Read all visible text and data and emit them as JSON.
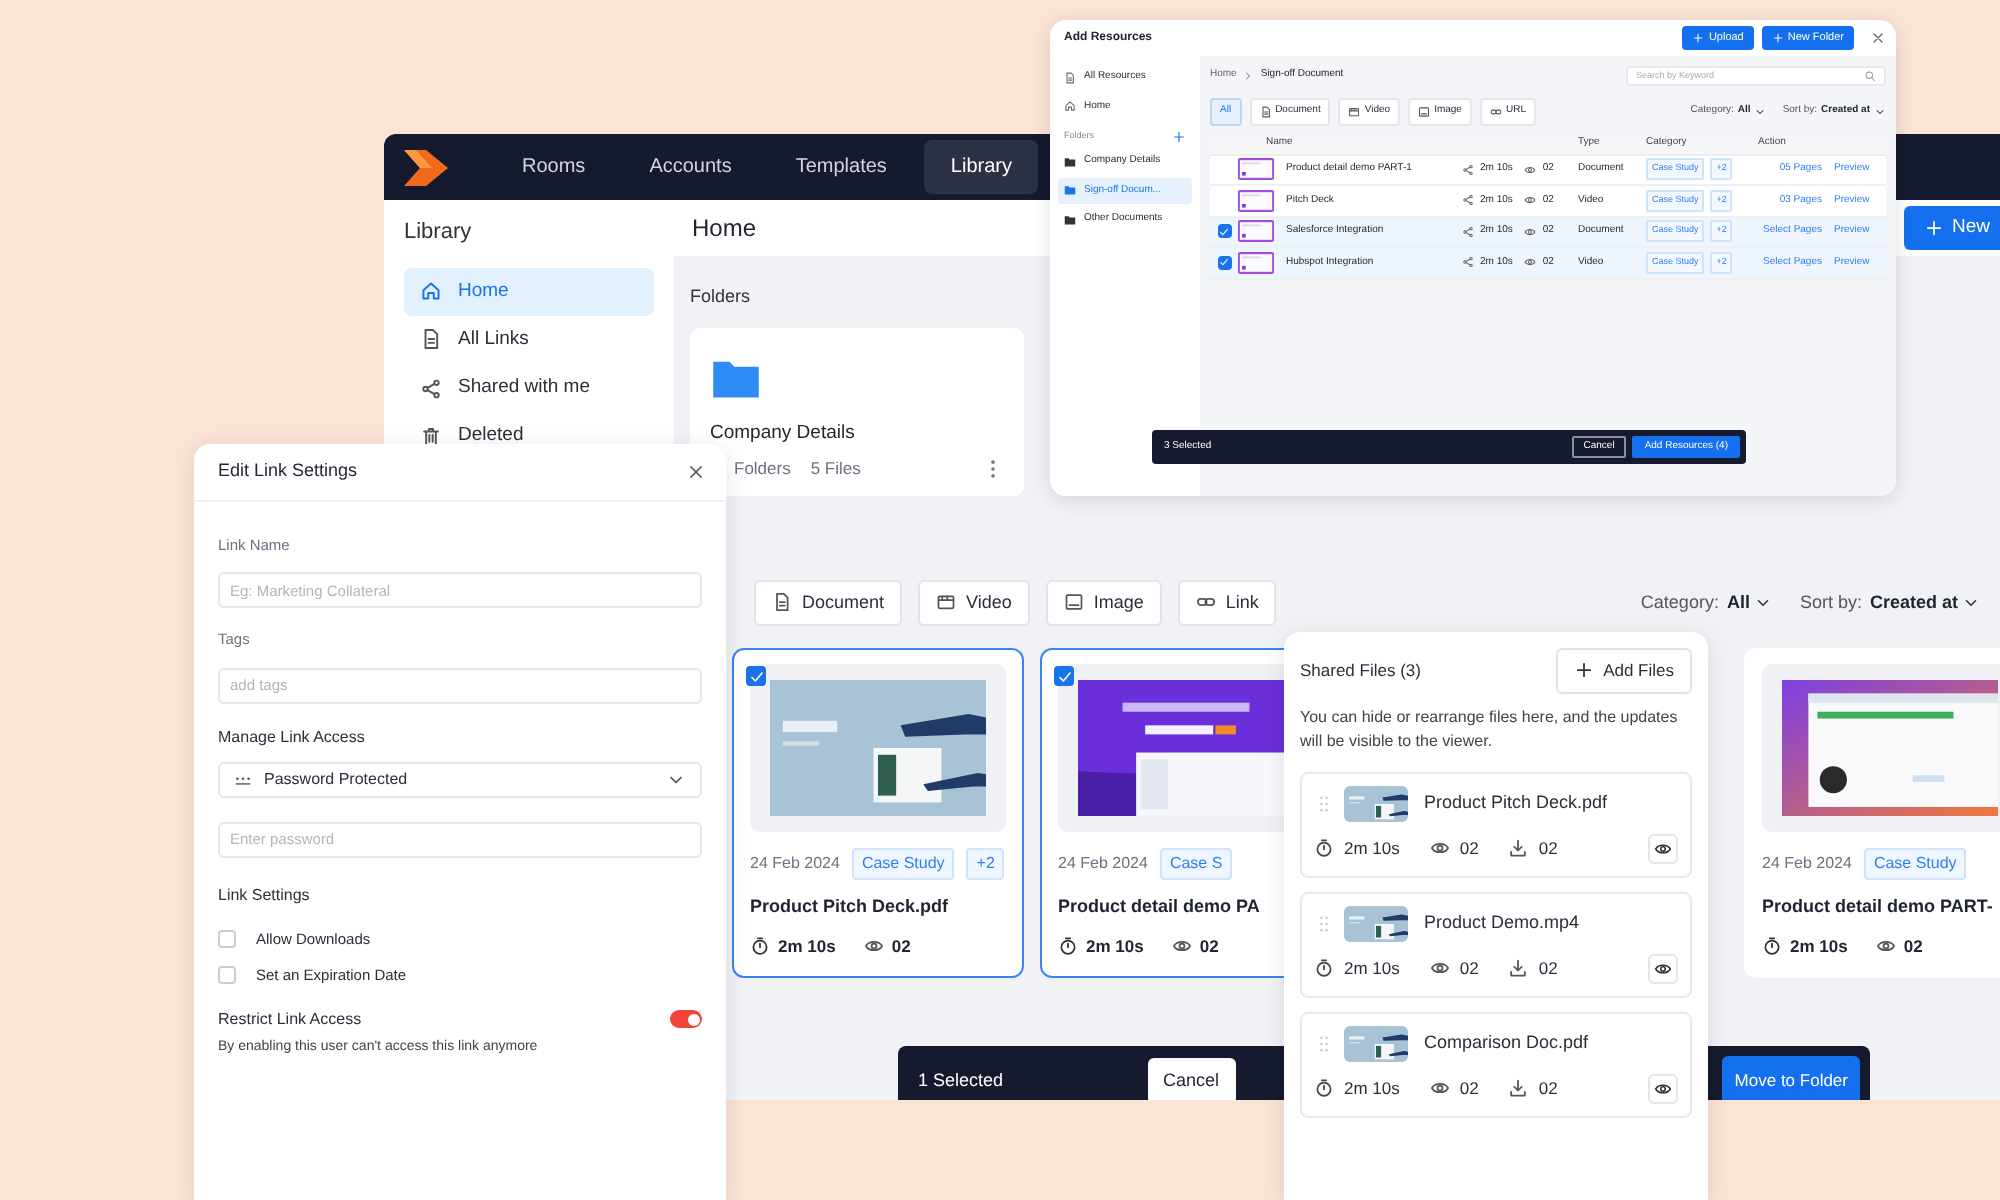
{
  "main_app": {
    "nav": [
      {
        "label": "Rooms",
        "selected": false
      },
      {
        "label": "Accounts",
        "selected": false
      },
      {
        "label": "Templates",
        "selected": false
      },
      {
        "label": "Library",
        "selected": true
      }
    ],
    "sidebar": {
      "title": "Library",
      "items": [
        {
          "label": "Home",
          "selected": true
        },
        {
          "label": "All Links",
          "selected": false
        },
        {
          "label": "Shared with me",
          "selected": false
        },
        {
          "label": "Deleted",
          "selected": false
        }
      ]
    },
    "header": {
      "title": "Home",
      "button": "New"
    },
    "folders_title": "Folders",
    "folders": [
      {
        "name": "Company Details",
        "folders": "Folders",
        "files": "5 Files"
      }
    ],
    "filters": [
      "Document",
      "Video",
      "Image",
      "Link"
    ],
    "category": {
      "label": "Category:",
      "value": "All"
    },
    "sort": {
      "label": "Sort by:",
      "value": "Created at"
    },
    "cards": [
      {
        "selected": true,
        "date": "24 Feb 2024",
        "tags": [
          "Case Study",
          "+2"
        ],
        "title": "Product Pitch Deck.pdf",
        "time": "2m 10s",
        "views": "02"
      },
      {
        "selected": true,
        "date": "24 Feb 2024",
        "tags": [
          "Case S"
        ],
        "title": "Product detail demo PA",
        "time": "2m 10s",
        "views": "02"
      },
      {
        "selected": false,
        "date": "24 Feb 2024",
        "tags": [
          "Case Study"
        ],
        "title": "Product detail demo PART-",
        "time": "2m 10s",
        "views": "02"
      }
    ],
    "selection_bar": {
      "count": "1 Selected",
      "cancel": "Cancel",
      "move": "Move to Folder"
    }
  },
  "add_resources": {
    "title": "Add Resources",
    "buttons": [
      "Upload",
      "New Folder"
    ],
    "nav": [
      {
        "label": "All Resources",
        "selected": false
      },
      {
        "label": "Home",
        "selected": false
      }
    ],
    "folders_title": "Folders",
    "folders": [
      {
        "label": "Company Details",
        "selected": false
      },
      {
        "label": "Sign-off Docum...",
        "selected": true
      },
      {
        "label": "Other Documents",
        "selected": false
      }
    ],
    "breadcrumb": [
      "Home",
      "Sign-off Document"
    ],
    "search": {
      "placeholder": "Search by Keyword"
    },
    "filters": [
      {
        "label": "All",
        "selected": true
      },
      {
        "label": "Document",
        "selected": false
      },
      {
        "label": "Video",
        "selected": false
      },
      {
        "label": "Image",
        "selected": false
      },
      {
        "label": "URL",
        "selected": false
      }
    ],
    "category": {
      "label": "Category:",
      "value": "All"
    },
    "sort": {
      "label": "Sort by:",
      "value": "Created at"
    },
    "columns": [
      "Name",
      "Type",
      "Category",
      "Action"
    ],
    "rows": [
      {
        "checked": false,
        "name": "Product detail demo PART-1",
        "time": "2m 10s",
        "views": "02",
        "type": "Document",
        "tags": [
          "Case Study",
          "+2"
        ],
        "action": "05 Pages",
        "preview": "Preview"
      },
      {
        "checked": false,
        "name": "Pitch Deck",
        "time": "2m 10s",
        "views": "02",
        "type": "Video",
        "tags": [
          "Case Study",
          "+2"
        ],
        "action": "03 Pages",
        "preview": "Preview"
      },
      {
        "checked": true,
        "name": "Salesforce Integration",
        "time": "2m 10s",
        "views": "02",
        "type": "Document",
        "tags": [
          "Case Study",
          "+2"
        ],
        "action": "Select Pages",
        "preview": "Preview"
      },
      {
        "checked": true,
        "name": "Hubspot Integration",
        "time": "2m 10s",
        "views": "02",
        "type": "Video",
        "tags": [
          "Case Study",
          "+2"
        ],
        "action": "Select Pages",
        "preview": "Preview"
      }
    ],
    "selection_bar": {
      "count": "3 Selected",
      "cancel": "Cancel",
      "confirm": "Add Resources (4)"
    }
  },
  "edit_link": {
    "title": "Edit Link Settings",
    "fields": [
      {
        "label": "Link Name",
        "placeholder": "Eg: Marketing Collateral"
      },
      {
        "label": "Tags",
        "placeholder": "add tags"
      }
    ],
    "access": {
      "label": "Manage Link Access",
      "value": "Password Protected",
      "password_placeholder": "Enter password"
    },
    "settings_title": "Link Settings",
    "options": [
      {
        "label": "Allow Downloads",
        "checked": false
      },
      {
        "label": "Set an Expiration Date",
        "checked": false
      }
    ],
    "restrict": {
      "label": "Restrict Link Access",
      "on": true,
      "note": "By enabling this user can't access this link anymore"
    }
  },
  "shared_files": {
    "title": "Shared Files (3)",
    "add_button": "Add Files",
    "note": "You can hide or rearrange files here, and the updates will be visible to the viewer.",
    "files": [
      {
        "name": "Product Pitch Deck.pdf",
        "time": "2m 10s",
        "views": "02",
        "downloads": "02"
      },
      {
        "name": "Product Demo.mp4",
        "time": "2m 10s",
        "views": "02",
        "downloads": "02"
      },
      {
        "name": "Comparison Doc.pdf",
        "time": "2m 10s",
        "views": "02",
        "downloads": "02"
      }
    ]
  }
}
